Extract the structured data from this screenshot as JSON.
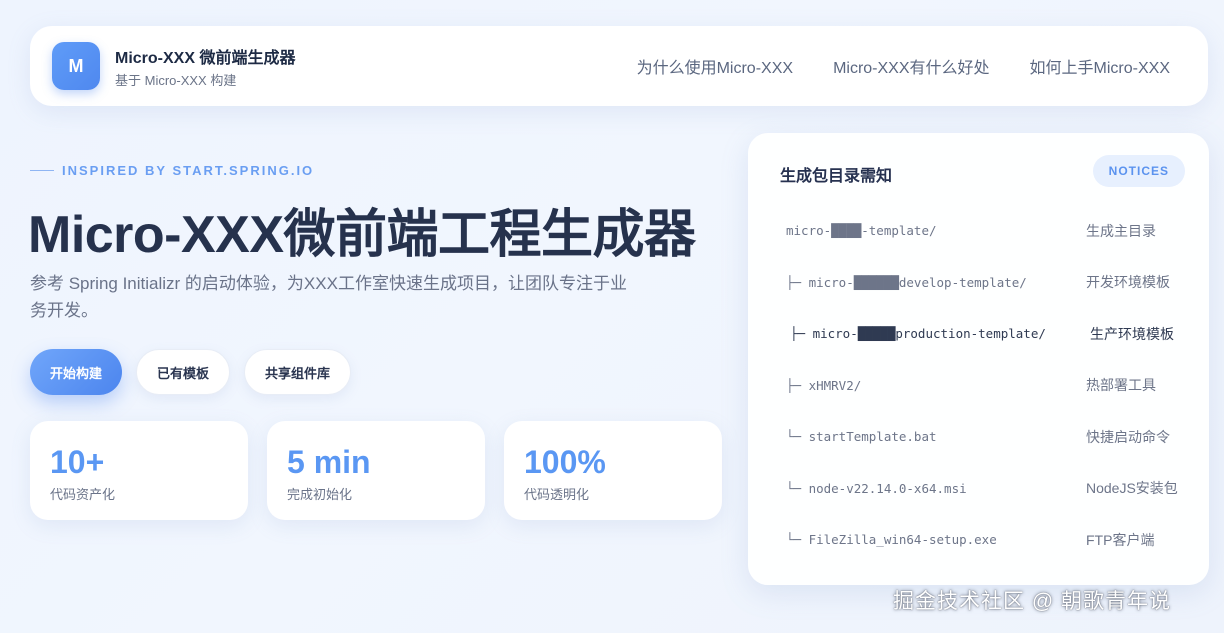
{
  "header": {
    "logo_letter": "M",
    "brand_title": "Micro-XXX 微前端生成器",
    "brand_subtitle": "基于 Micro-XXX 构建",
    "nav": [
      {
        "label": "为什么使用Micro-XXX"
      },
      {
        "label": "Micro-XXX有什么好处"
      },
      {
        "label": "如何上手Micro-XXX"
      }
    ]
  },
  "hero": {
    "eyebrow": "INSPIRED BY START.SPRING.IO",
    "title": "Micro-XXX微前端工程生成器",
    "description": "参考 Spring Initializr 的启动体验，为XXX工作室快速生成项目，让团队专注于业务开发。",
    "buttons": {
      "primary": "开始构建",
      "templates": "已有模板",
      "components": "共享组件库"
    }
  },
  "stats": [
    {
      "value": "10+",
      "label": "代码资产化"
    },
    {
      "value": "5 min",
      "label": "完成初始化"
    },
    {
      "value": "100%",
      "label": "代码透明化"
    }
  ],
  "notices": {
    "title": "生成包目录需知",
    "badge": "NOTICES",
    "rows": [
      {
        "path": "micro-████-template/",
        "desc": "生成主目录"
      },
      {
        "path": "├─ micro-██████develop-template/",
        "desc": "开发环境模板"
      },
      {
        "path": "├─ micro-█████production-template/",
        "desc": "生产环境模板"
      },
      {
        "path": "├─ xHMRV2/",
        "desc": "热部署工具"
      },
      {
        "path": "└─ startTemplate.bat",
        "desc": "快捷启动命令"
      },
      {
        "path": "└─ node-v22.14.0-x64.msi",
        "desc": "NodeJS安装包"
      },
      {
        "path": "└─ FileZilla_win64-setup.exe",
        "desc": "FTP客户端"
      }
    ]
  },
  "watermark": "掘金技术社区 @ 朝歌青年说",
  "colors": {
    "accent": "#5a97f3",
    "primary_button": "#4c85ee",
    "title": "#26324d",
    "muted": "#6a7389"
  }
}
